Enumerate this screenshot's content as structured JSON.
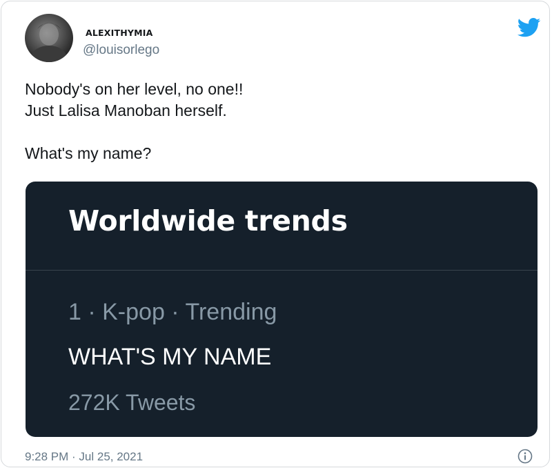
{
  "user": {
    "display_name": "ALEXITHYMIA",
    "handle": "@louisorlego"
  },
  "tweet": {
    "lines": [
      "Nobody's on her level, no one!!",
      "Just Lalisa Manoban herself.",
      "What's my name?"
    ],
    "timestamp": "9:28 PM · Jul 25, 2021"
  },
  "trend_card": {
    "title": "Worldwide trends",
    "meta": "1 · K-pop · Trending",
    "name": "WHAT'S MY NAME",
    "count": "272K Tweets"
  },
  "icons": {
    "brand": "twitter-bird-icon",
    "info": "info-icon"
  },
  "colors": {
    "brand": "#1da1f2",
    "card_background": "#15202b",
    "muted_text": "#657786"
  }
}
